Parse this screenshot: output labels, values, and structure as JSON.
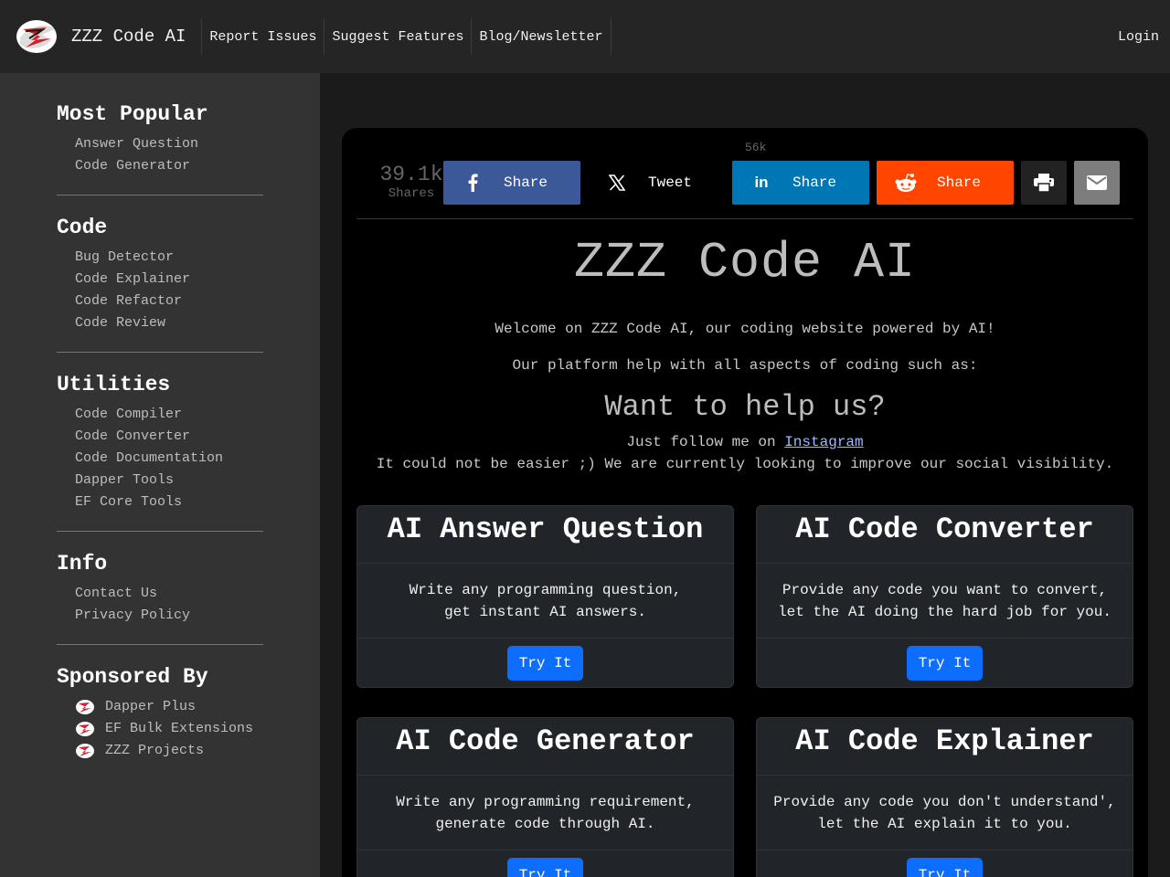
{
  "header": {
    "brand": "ZZZ Code AI",
    "nav": [
      "Report Issues",
      "Suggest Features",
      "Blog/Newsletter"
    ],
    "login": "Login"
  },
  "sidebar": {
    "sections": [
      {
        "title": "Most Popular",
        "items": [
          "Answer Question",
          "Code Generator"
        ]
      },
      {
        "title": "Code",
        "items": [
          "Bug Detector",
          "Code Explainer",
          "Code Refactor",
          "Code Review"
        ]
      },
      {
        "title": "Utilities",
        "items": [
          "Code Compiler",
          "Code Converter",
          "Code Documentation",
          "Dapper Tools",
          "EF Core Tools"
        ]
      },
      {
        "title": "Info",
        "items": [
          "Contact Us",
          "Privacy Policy"
        ]
      }
    ],
    "sponsored": {
      "title": "Sponsored By",
      "items": [
        "Dapper Plus",
        "EF Bulk Extensions",
        "ZZZ Projects"
      ]
    }
  },
  "share": {
    "count": "39.1k",
    "count_label": "Shares",
    "floating_count": "56k",
    "buttons": {
      "facebook": "Share",
      "twitter": "Tweet",
      "linkedin": "Share",
      "reddit": "Share"
    }
  },
  "hero": {
    "title": "ZZZ Code AI",
    "welcome": "Welcome on ZZZ Code AI, our coding website powered by AI!",
    "platform": "Our platform help with all aspects of coding such as:",
    "help_title": "Want to help us?",
    "follow_prefix": "Just follow me on ",
    "follow_link": "Instagram",
    "follow_suffix": "It could not be easier ;) We are currently looking to improve our social visibility."
  },
  "cards": [
    {
      "title": "AI Answer Question",
      "line1": "Write any programming question,",
      "line2": "get instant AI answers.",
      "button": "Try It"
    },
    {
      "title": "AI Code Converter",
      "line1": "Provide any code you want to convert,",
      "line2": "let the AI doing the hard job for you.",
      "button": "Try It"
    },
    {
      "title": "AI Code Generator",
      "line1": "Write any programming requirement,",
      "line2": "generate code through AI.",
      "button": "Try It"
    },
    {
      "title": "AI Code Explainer",
      "line1": "Provide any code you don't understand',",
      "line2": "let the AI explain it to you.",
      "button": "Try It"
    }
  ],
  "colors": {
    "facebook": "#3b5998",
    "linkedin": "#0077b5",
    "reddit": "#ff4500",
    "primary_button": "#0d6efd"
  }
}
